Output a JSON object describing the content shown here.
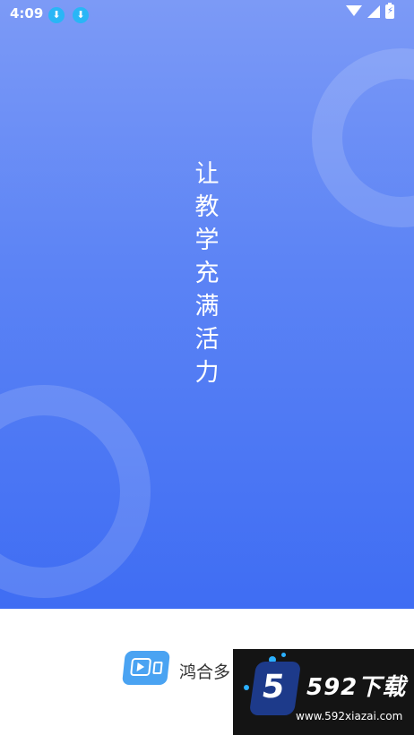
{
  "status_bar": {
    "time": "4:09",
    "download_icon_1": "download-icon",
    "download_icon_2": "download-icon"
  },
  "hero": {
    "slogan_chars": [
      "让",
      "教",
      "学",
      "充",
      "满",
      "活",
      "力"
    ]
  },
  "footer": {
    "app_name": "鸿合多"
  },
  "watermark": {
    "brand": "592下载",
    "badge": "5",
    "url": "www.592xiazai.com"
  },
  "colors": {
    "hero_top": "#7c9af6",
    "hero_bottom": "#3f6df3",
    "logo": "#4aa3f2",
    "watermark_bg": "#141414"
  }
}
